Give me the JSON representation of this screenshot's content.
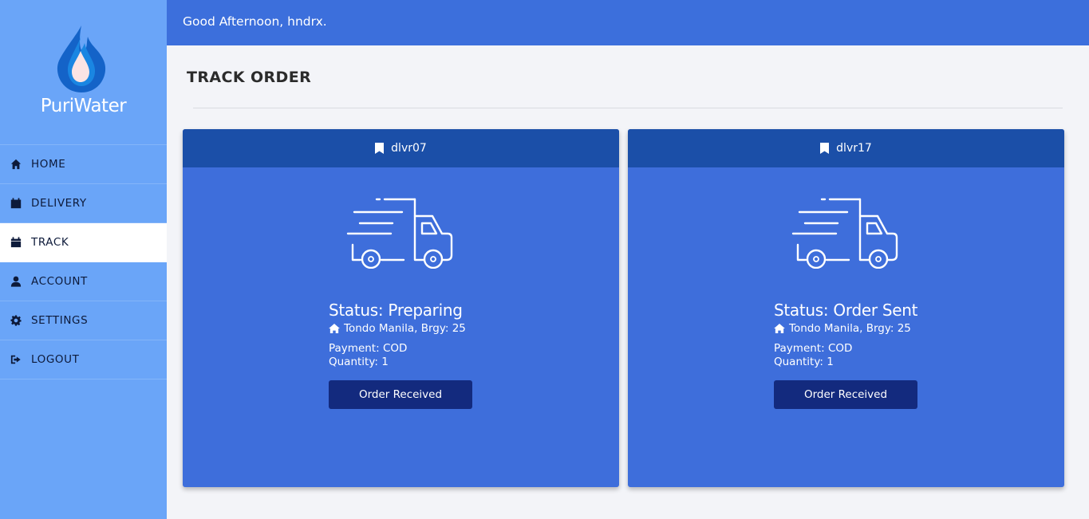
{
  "brand": {
    "name": "PuriWater"
  },
  "header": {
    "greeting": "Good Afternoon, hndrx."
  },
  "sidebar": {
    "items": [
      {
        "label": "HOME",
        "icon": "home-icon",
        "active": false
      },
      {
        "label": "DELIVERY",
        "icon": "calendar-icon",
        "active": false
      },
      {
        "label": "TRACK",
        "icon": "calendar-icon",
        "active": true
      },
      {
        "label": "ACCOUNT",
        "icon": "user-icon",
        "active": false
      },
      {
        "label": "SETTINGS",
        "icon": "gear-icon",
        "active": false
      },
      {
        "label": "LOGOUT",
        "icon": "logout-icon",
        "active": false
      }
    ]
  },
  "main": {
    "title": "TRACK ORDER",
    "orders": [
      {
        "id": "dlvr07",
        "status": "Status: Preparing",
        "address": "Tondo Manila, Brgy: 25",
        "payment": "Payment: COD",
        "quantity": "Quantity: 1",
        "button_label": "Order Received"
      },
      {
        "id": "dlvr17",
        "status": "Status: Order Sent",
        "address": "Tondo Manila, Brgy: 25",
        "payment": "Payment: COD",
        "quantity": "Quantity: 1",
        "button_label": "Order Received"
      }
    ]
  },
  "colors": {
    "sidebar": "#6aa5f8",
    "topbar": "#3c6fdc",
    "card": "#3e6edb",
    "card_header": "#1b4fa8",
    "button": "#132a7e"
  }
}
